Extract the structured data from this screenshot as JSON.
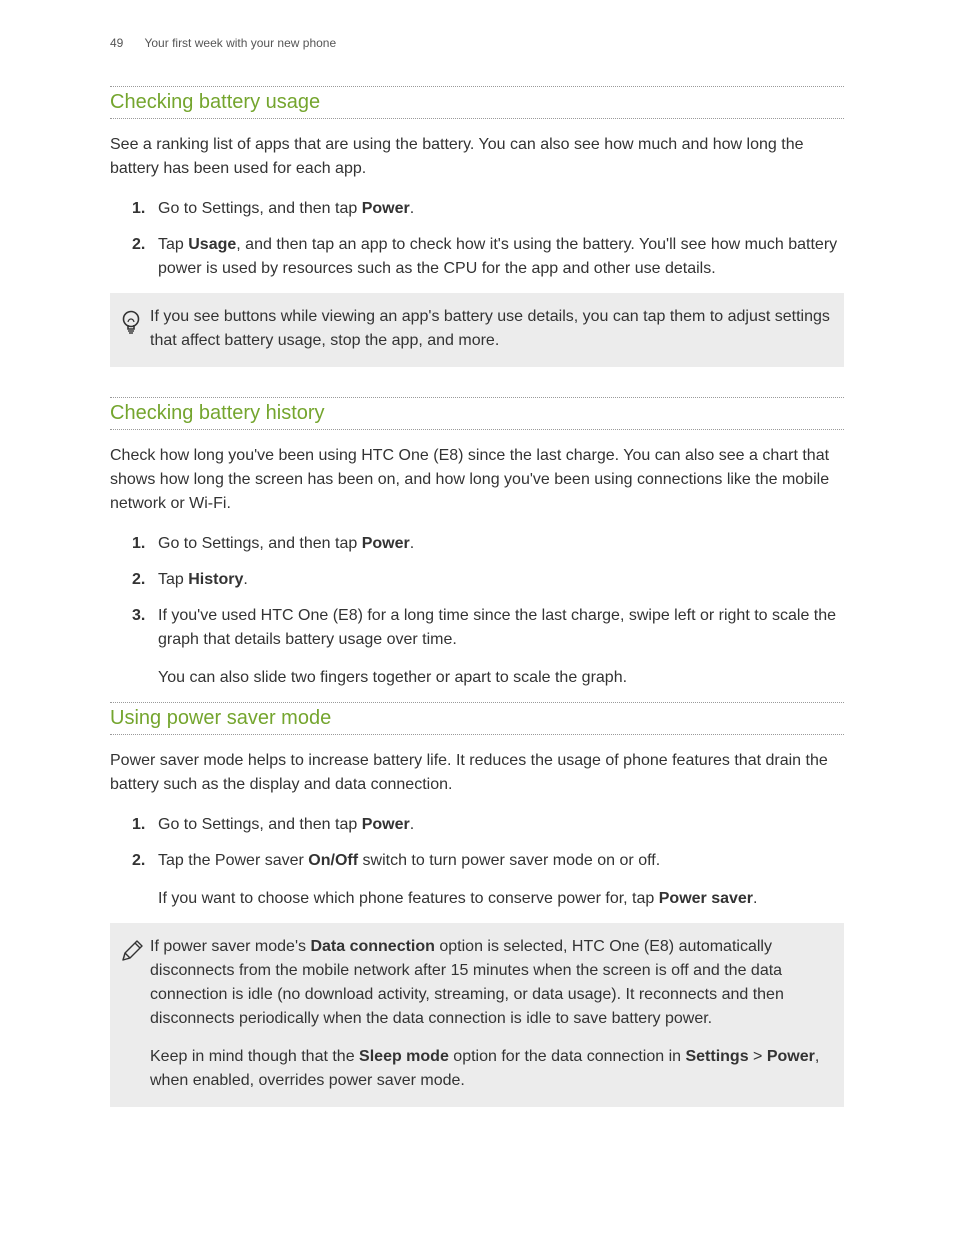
{
  "header": {
    "page_number": "49",
    "chapter_title": "Your first week with your new phone"
  },
  "sections": {
    "s1": {
      "heading": "Checking battery usage",
      "intro": "See a ranking list of apps that are using the battery. You can also see how much and how long the battery has been used for each app.",
      "step1_a": "Go to Settings, and then tap ",
      "step1_b": "Power",
      "step1_c": ".",
      "step2_a": "Tap ",
      "step2_b": "Usage",
      "step2_c": ", and then tap an app to check how it's using the battery. You'll see how much battery power is used by resources such as the CPU for the app and other use details.",
      "tip": "If you see buttons while viewing an app's battery use details, you can tap them to adjust settings that affect battery usage, stop the app, and more."
    },
    "s2": {
      "heading": "Checking battery history",
      "intro": "Check how long you've been using HTC One (E8) since the last charge. You can also see a chart that shows how long the screen has been on, and how long you've been using connections like the mobile network or Wi-Fi.",
      "step1_a": "Go to Settings, and then tap ",
      "step1_b": "Power",
      "step1_c": ".",
      "step2_a": "Tap ",
      "step2_b": "History",
      "step2_c": ".",
      "step3": "If you've used HTC One (E8) for a long time since the last charge, swipe left or right to scale the graph that details battery usage over time.",
      "step3_sub": "You can also slide two fingers together or apart to scale the graph."
    },
    "s3": {
      "heading": "Using power saver mode",
      "intro": "Power saver mode helps to increase battery life. It reduces the usage of phone features that drain the battery such as the display and data connection.",
      "step1_a": "Go to Settings, and then tap ",
      "step1_b": "Power",
      "step1_c": ".",
      "step2_a": "Tap the Power saver ",
      "step2_b": "On/Off",
      "step2_c": " switch to turn power saver mode on or off.",
      "step2_sub_a": "If you want to choose which phone features to conserve power for, tap ",
      "step2_sub_b": "Power saver",
      "step2_sub_c": ".",
      "note_p1_a": "If power saver mode's ",
      "note_p1_b": "Data connection",
      "note_p1_c": " option is selected, HTC One (E8) automatically disconnects from the mobile network after 15 minutes when the screen is off and the data connection is idle (no download activity, streaming, or data usage). It reconnects and then disconnects periodically when the data connection is idle to save battery power.",
      "note_p2_a": "Keep in mind though that the ",
      "note_p2_b": "Sleep mode",
      "note_p2_c": " option for the data connection in ",
      "note_p2_d": "Settings",
      "note_p2_e": " > ",
      "note_p2_f": "Power",
      "note_p2_g": ", when enabled, overrides power saver mode."
    }
  }
}
